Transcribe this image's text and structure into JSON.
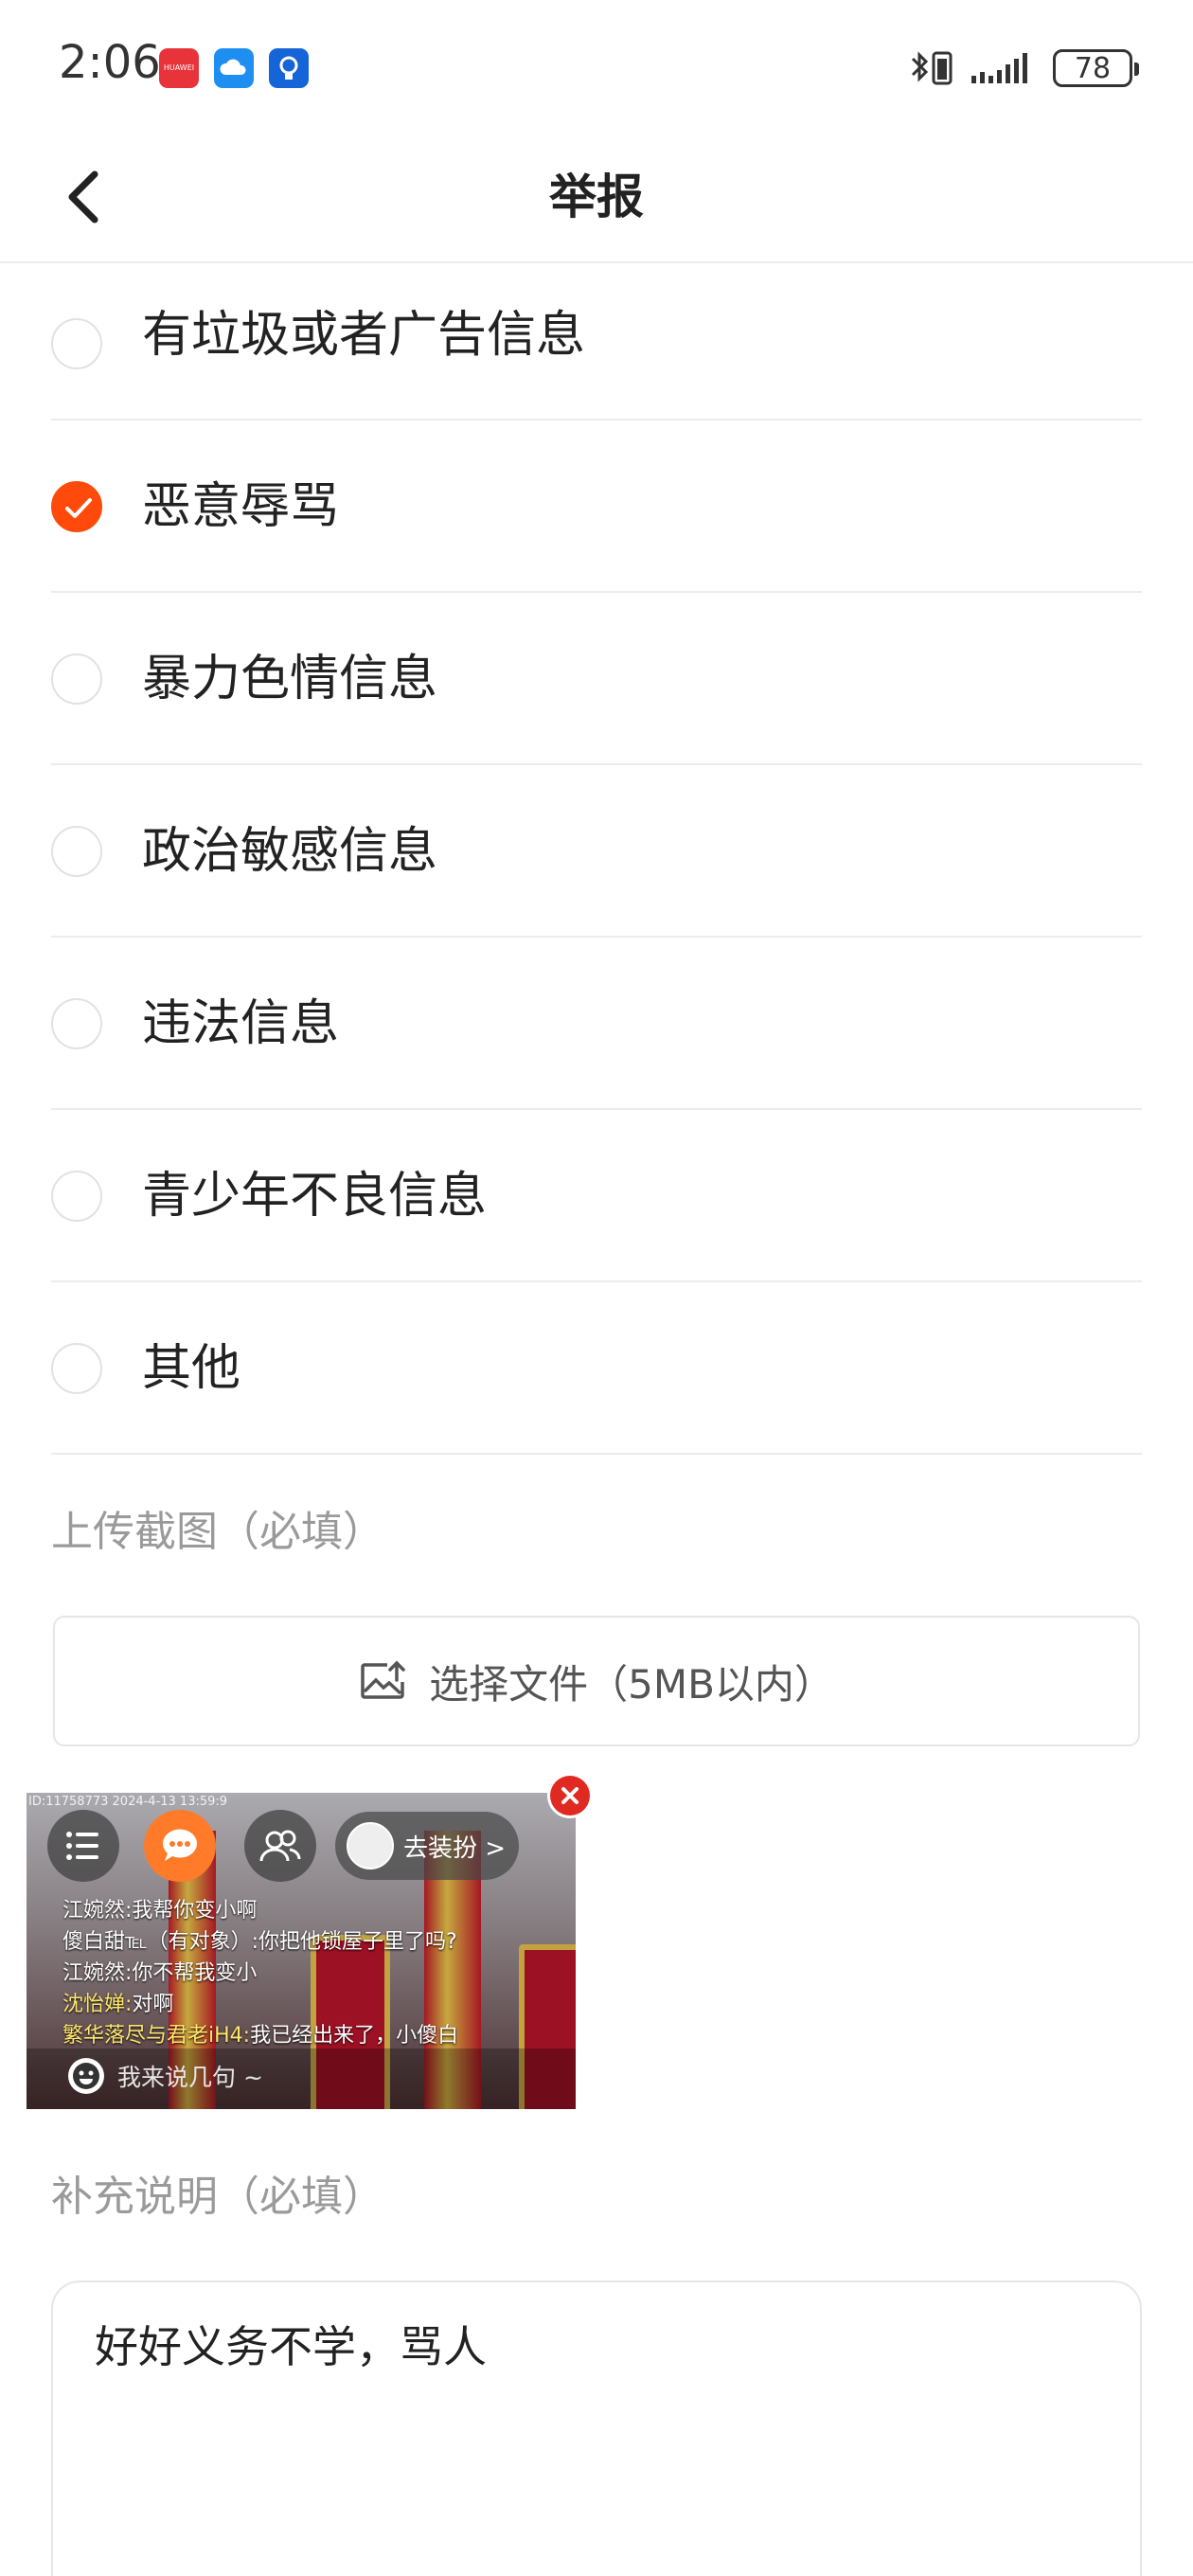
{
  "status_bar": {
    "time": "2:06",
    "app_icons": [
      {
        "name": "huawei-store-icon",
        "color": "#e8333a",
        "text": "HUAWEI"
      },
      {
        "name": "cloud-icon",
        "color": "#1e8ef0"
      },
      {
        "name": "lightbulb-icon",
        "color": "#1565d8"
      }
    ],
    "battery": "78"
  },
  "header": {
    "title": "举报"
  },
  "options": [
    {
      "label": "有垃圾或者广告信息",
      "checked": false
    },
    {
      "label": "恶意辱骂",
      "checked": true
    },
    {
      "label": "暴力色情信息",
      "checked": false
    },
    {
      "label": "政治敏感信息",
      "checked": false
    },
    {
      "label": "违法信息",
      "checked": false
    },
    {
      "label": "青少年不良信息",
      "checked": false
    },
    {
      "label": "其他",
      "checked": false
    }
  ],
  "upload": {
    "section_label": "上传截图（必填）",
    "button_label": "选择文件（5MB以内）"
  },
  "thumbnail": {
    "meta": "ID:11758773 2024-4-13 13:59:9",
    "decorate_label": "去装扮 >",
    "chat": [
      {
        "name": "江婉然:",
        "text": "我帮你变小啊"
      },
      {
        "name": "傻白甜℡（有对象）:",
        "text": "你把他锁屋子里了吗?"
      },
      {
        "name": "江婉然:",
        "text": "你不帮我变小"
      },
      {
        "name": "沈怡婵:",
        "text": "对啊"
      },
      {
        "name": "繁华落尽与君老iH4:",
        "text": "我已经出来了，小傻白"
      }
    ],
    "input_placeholder": "我来说几句 ~"
  },
  "description": {
    "section_label": "补充说明（必填）",
    "value": "好好义务不学，骂人"
  },
  "colors": {
    "accent": "#ff4a0c",
    "divider": "#ececec",
    "muted_text": "#9a9a9a"
  }
}
